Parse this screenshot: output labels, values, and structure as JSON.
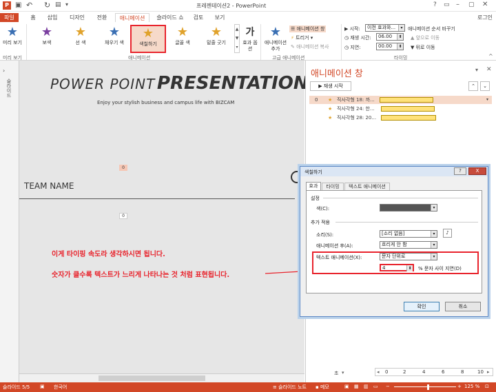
{
  "window": {
    "title": "프레젠테이션2 - PowerPoint",
    "login": "로그인"
  },
  "tabs": [
    {
      "label": "파일"
    },
    {
      "label": "홈"
    },
    {
      "label": "삽입"
    },
    {
      "label": "디자인"
    },
    {
      "label": "전환"
    },
    {
      "label": "애니메이션"
    },
    {
      "label": "슬라이드 쇼"
    },
    {
      "label": "검토"
    },
    {
      "label": "보기"
    }
  ],
  "ribbon": {
    "preview": "미리 보기",
    "preview_group": "미리 보기",
    "gallery": [
      {
        "label": "보색"
      },
      {
        "label": "선 색"
      },
      {
        "label": "채우기 색"
      },
      {
        "label": "색칠하기"
      },
      {
        "label": "글꼴 색"
      },
      {
        "label": "밑줄 긋기"
      }
    ],
    "anim_group": "애니메이션",
    "effect_options": "효과 옵션",
    "add_anim": "애니메이션 추가",
    "anim_pane": "애니메이션 창",
    "trigger": "트리거",
    "anim_painter": "애니메이션 복사",
    "adv_group": "고급 애니메이션",
    "start_label": "시작:",
    "start_value": "이전 효과와...",
    "duration_label": "재생 시간:",
    "duration_value": "06.00",
    "delay_label": "지연:",
    "delay_value": "00.00",
    "reorder": "애니메이션 순서 바꾸기",
    "move_earlier": "앞으로 이동",
    "move_later": "뒤로 이동",
    "timing_group": "타이밍"
  },
  "slide": {
    "title_thin": "POWER POINT",
    "title_bold": "PRESENTATION",
    "subtitle": "Enjoy your stylish business and campus life with BIZCAM",
    "badge_top": "0",
    "team_name": "TEAM NAME",
    "badge_bottom": "0",
    "annotation1": "이게 타이핑 속도라 생각하시면 됩니다.",
    "annotation2": "숫자가 클수록 텍스트가 느리게 나타나는 것 처럼 표현됩니다."
  },
  "left_panel": {
    "label": "슬라이드"
  },
  "anim_pane": {
    "title": "애니메이션 창",
    "play": "재생 시작",
    "rows": [
      {
        "index": "0",
        "label": "직사각형 18: 까..."
      },
      {
        "index": "",
        "label": "직사각형 24: 한..."
      },
      {
        "index": "",
        "label": "직사각형 28: 20..."
      }
    ],
    "footer_sec": "초",
    "ruler": [
      "0",
      "2",
      "4",
      "6",
      "8",
      "10"
    ]
  },
  "dialog": {
    "title": "색칠하기",
    "tabs": [
      "효과",
      "타이밍",
      "텍스트 애니메이션"
    ],
    "settings_group": "설정",
    "color_label": "색(C):",
    "enhance_group": "추가 적용",
    "sound_label": "소리(S):",
    "sound_value": "[소리 없음]",
    "after_label": "애니메이션 후(A):",
    "after_value": "흐리게 안 함",
    "text_anim_label": "텍스트 애니메이션(X):",
    "text_anim_value": "문자 단위로",
    "delay_value": "4",
    "delay_suffix": "% 문자 사이 지연(D)",
    "ok": "확인",
    "cancel": "취소",
    "help": "?",
    "close": "X"
  },
  "status": {
    "slide": "슬라이드 5/5",
    "lang": "한국어",
    "notes": "슬라이드 노트",
    "memo": "메모",
    "zoom": "125 %"
  },
  "colors": {
    "accent": "#d24726",
    "red": "#e8232c",
    "bar": "#ffe27a"
  }
}
